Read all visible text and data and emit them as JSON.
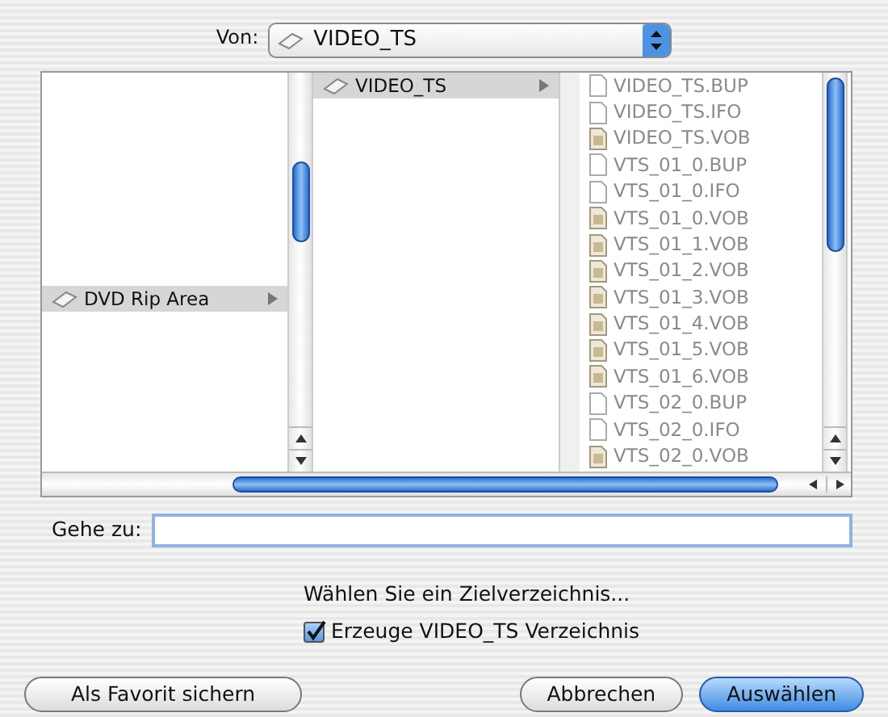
{
  "from": {
    "label": "Von:",
    "value": "VIDEO_TS"
  },
  "columns": [
    {
      "items": [
        {
          "name": "DVD Rip Area",
          "kind": "volume",
          "selected": true,
          "disabled": false,
          "has_children": true
        }
      ]
    },
    {
      "items": [
        {
          "name": "VIDEO_TS",
          "kind": "volume",
          "selected": true,
          "disabled": false,
          "has_children": true
        }
      ]
    },
    {
      "items": [
        {
          "name": "VIDEO_TS.BUP",
          "kind": "doc",
          "selected": false,
          "disabled": true,
          "has_children": false
        },
        {
          "name": "VIDEO_TS.IFO",
          "kind": "doc",
          "selected": false,
          "disabled": true,
          "has_children": false
        },
        {
          "name": "VIDEO_TS.VOB",
          "kind": "video",
          "selected": false,
          "disabled": true,
          "has_children": false
        },
        {
          "name": "VTS_01_0.BUP",
          "kind": "doc",
          "selected": false,
          "disabled": true,
          "has_children": false
        },
        {
          "name": "VTS_01_0.IFO",
          "kind": "doc",
          "selected": false,
          "disabled": true,
          "has_children": false
        },
        {
          "name": "VTS_01_0.VOB",
          "kind": "video",
          "selected": false,
          "disabled": true,
          "has_children": false
        },
        {
          "name": "VTS_01_1.VOB",
          "kind": "video",
          "selected": false,
          "disabled": true,
          "has_children": false
        },
        {
          "name": "VTS_01_2.VOB",
          "kind": "video",
          "selected": false,
          "disabled": true,
          "has_children": false
        },
        {
          "name": "VTS_01_3.VOB",
          "kind": "video",
          "selected": false,
          "disabled": true,
          "has_children": false
        },
        {
          "name": "VTS_01_4.VOB",
          "kind": "video",
          "selected": false,
          "disabled": true,
          "has_children": false
        },
        {
          "name": "VTS_01_5.VOB",
          "kind": "video",
          "selected": false,
          "disabled": true,
          "has_children": false
        },
        {
          "name": "VTS_01_6.VOB",
          "kind": "video",
          "selected": false,
          "disabled": true,
          "has_children": false
        },
        {
          "name": "VTS_02_0.BUP",
          "kind": "doc",
          "selected": false,
          "disabled": true,
          "has_children": false
        },
        {
          "name": "VTS_02_0.IFO",
          "kind": "doc",
          "selected": false,
          "disabled": true,
          "has_children": false
        },
        {
          "name": "VTS_02_0.VOB",
          "kind": "video",
          "selected": false,
          "disabled": true,
          "has_children": false
        }
      ]
    }
  ],
  "goto": {
    "label": "Gehe zu:"
  },
  "prompt": "Wählen Sie ein Zielverzeichnis...",
  "checkbox": {
    "label": "Erzeuge VIDEO_TS Verzeichnis",
    "checked": true
  },
  "buttons": [
    {
      "label": "Als Favorit sichern",
      "kind": "plain"
    },
    {
      "label": "Abbrechen",
      "kind": "plain"
    },
    {
      "label": "Auswählen",
      "kind": "default"
    }
  ]
}
